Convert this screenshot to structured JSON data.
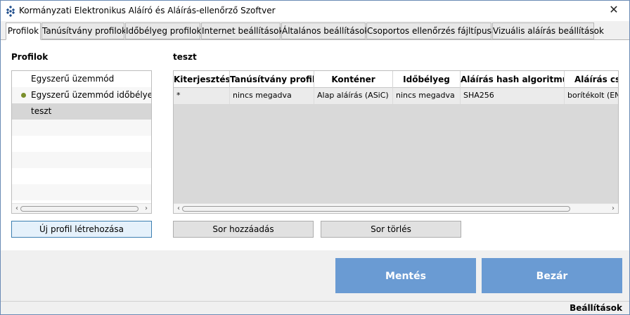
{
  "window": {
    "title": "Kormányzati Elektronikus Aláíró és Aláírás-ellenőrző Szoftver",
    "close_glyph": "✕",
    "app_icon": "diamond-grid-icon"
  },
  "tabs": [
    {
      "label": "Profilok",
      "active": true
    },
    {
      "label": "Tanúsítvány profilok"
    },
    {
      "label": "Időbélyeg profilok"
    },
    {
      "label": "Internet beállítások"
    },
    {
      "label": "Általános beállítások"
    },
    {
      "label": "Csoportos ellenőrzés fájltípusai"
    },
    {
      "label": "Vizuális aláírás beállítások"
    }
  ],
  "profiles": {
    "heading": "Profilok",
    "items": [
      {
        "label": "Egyszerű üzemmód"
      },
      {
        "label": "Egyszerű üzemmód időbélyegge",
        "default": true
      },
      {
        "label": "teszt",
        "selected": true
      }
    ],
    "create_button": "Új profil létrehozása"
  },
  "detail": {
    "heading": "teszt",
    "columns": [
      "Kiterjesztés",
      "Tanúsítvány profil",
      "Konténer",
      "Időbélyeg",
      "Aláírás hash algoritmusa",
      "Aláírás cso"
    ],
    "rows": [
      [
        "*",
        "nincs megadva",
        "Alap aláírás (ASiC)",
        "nincs megadva",
        "SHA256",
        "borítékolt (ENV"
      ]
    ],
    "add_row_button": "Sor hozzáadás",
    "delete_row_button": "Sor törlés"
  },
  "footer": {
    "save_button": "Mentés",
    "close_button": "Bezár",
    "status": "Beállítások"
  },
  "colors": {
    "primary_button": "#6a9bd3",
    "default_marker": "#7a8f2c",
    "selection": "#d6d6d6"
  }
}
